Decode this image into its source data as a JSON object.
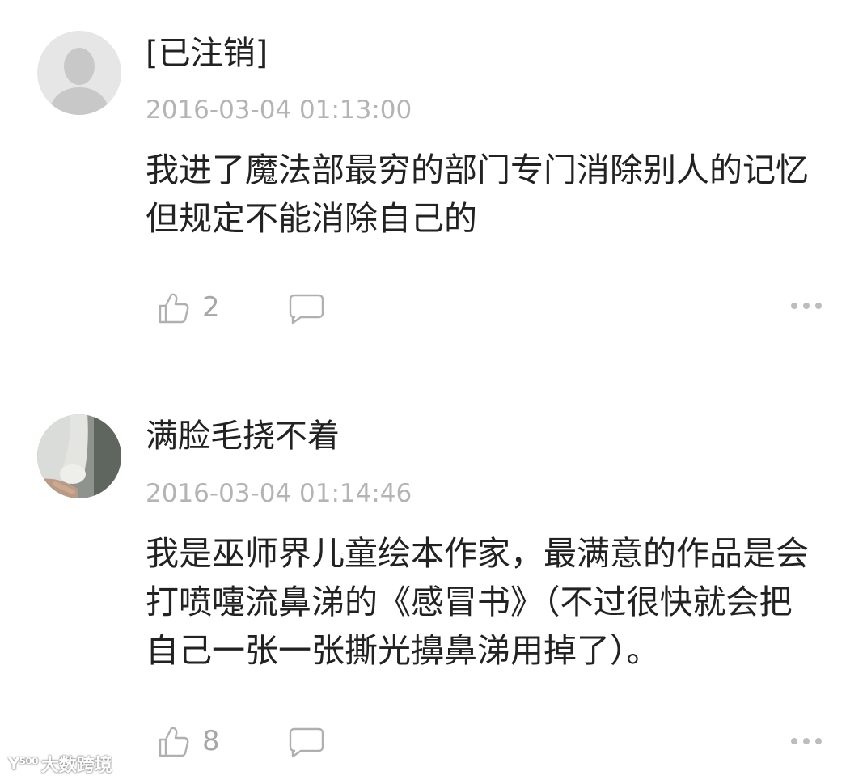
{
  "comments": [
    {
      "username": "[已注销]",
      "time": "2016-03-04 01:13:00",
      "text": "我进了魔法部最穷的部门专门消除别人的记忆但规定不能消除自己的",
      "likes": "2",
      "avatar": "default-user-silhouette"
    },
    {
      "username": "满脸毛挠不着",
      "time": "2016-03-04 01:14:46",
      "text": "我是巫师界儿童绘本作家，最满意的作品是会打喷嚏流鼻涕的《感冒书》（不过很快就会把自己一张一张撕光擤鼻涕用掉了）。",
      "likes": "8",
      "avatar": "cat-paw-photo"
    }
  ],
  "watermark": {
    "logo": "Y⁵⁰⁰",
    "text": "大数跨境"
  },
  "colors": {
    "text": "#222222",
    "meta": "#b4b4b4",
    "icon": "#b0b0b0"
  }
}
